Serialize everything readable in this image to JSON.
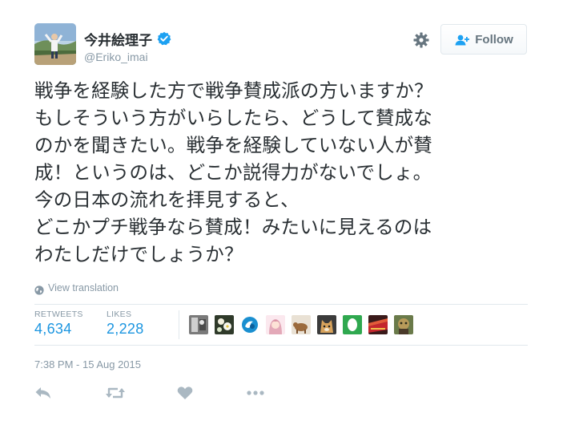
{
  "author": {
    "display_name": "今井絵理子",
    "handle": "@Eriko_imai",
    "verified": true
  },
  "follow_button": {
    "label": "Follow"
  },
  "tweet": {
    "lines": [
      "戦争を経験した方で戦争賛成派の方いますか？",
      "もしそういう方がいらしたら、どうして賛成な",
      "のかを聞きたい。戦争を経験していない人が賛",
      "成！というのは、どこか説得力がないでしょ。",
      "今の日本の流れを拝見すると、",
      "どこかプチ戦争なら賛成！みたいに見えるのは",
      "わたしだけでしょうか？"
    ],
    "translate_label": "View translation"
  },
  "stats": {
    "retweets_label": "RETWEETS",
    "retweets_value": "4,634",
    "likes_label": "LIKES",
    "likes_value": "2,228"
  },
  "likers": [
    {
      "icon": "user-avatar-1"
    },
    {
      "icon": "user-avatar-2"
    },
    {
      "icon": "user-avatar-3"
    },
    {
      "icon": "user-avatar-4"
    },
    {
      "icon": "user-avatar-5"
    },
    {
      "icon": "user-avatar-6"
    },
    {
      "icon": "user-avatar-7"
    },
    {
      "icon": "user-avatar-8"
    },
    {
      "icon": "user-avatar-9"
    }
  ],
  "timestamp": "7:38 PM - 15 Aug 2015",
  "actions": [
    "reply-icon",
    "retweet-icon",
    "like-icon",
    "more-icon"
  ],
  "colors": {
    "text": "#292f33",
    "muted": "#8899a6",
    "link_blue": "#1b95e0",
    "verified_blue": "#1da1f2",
    "divider": "#e1e8ed"
  }
}
